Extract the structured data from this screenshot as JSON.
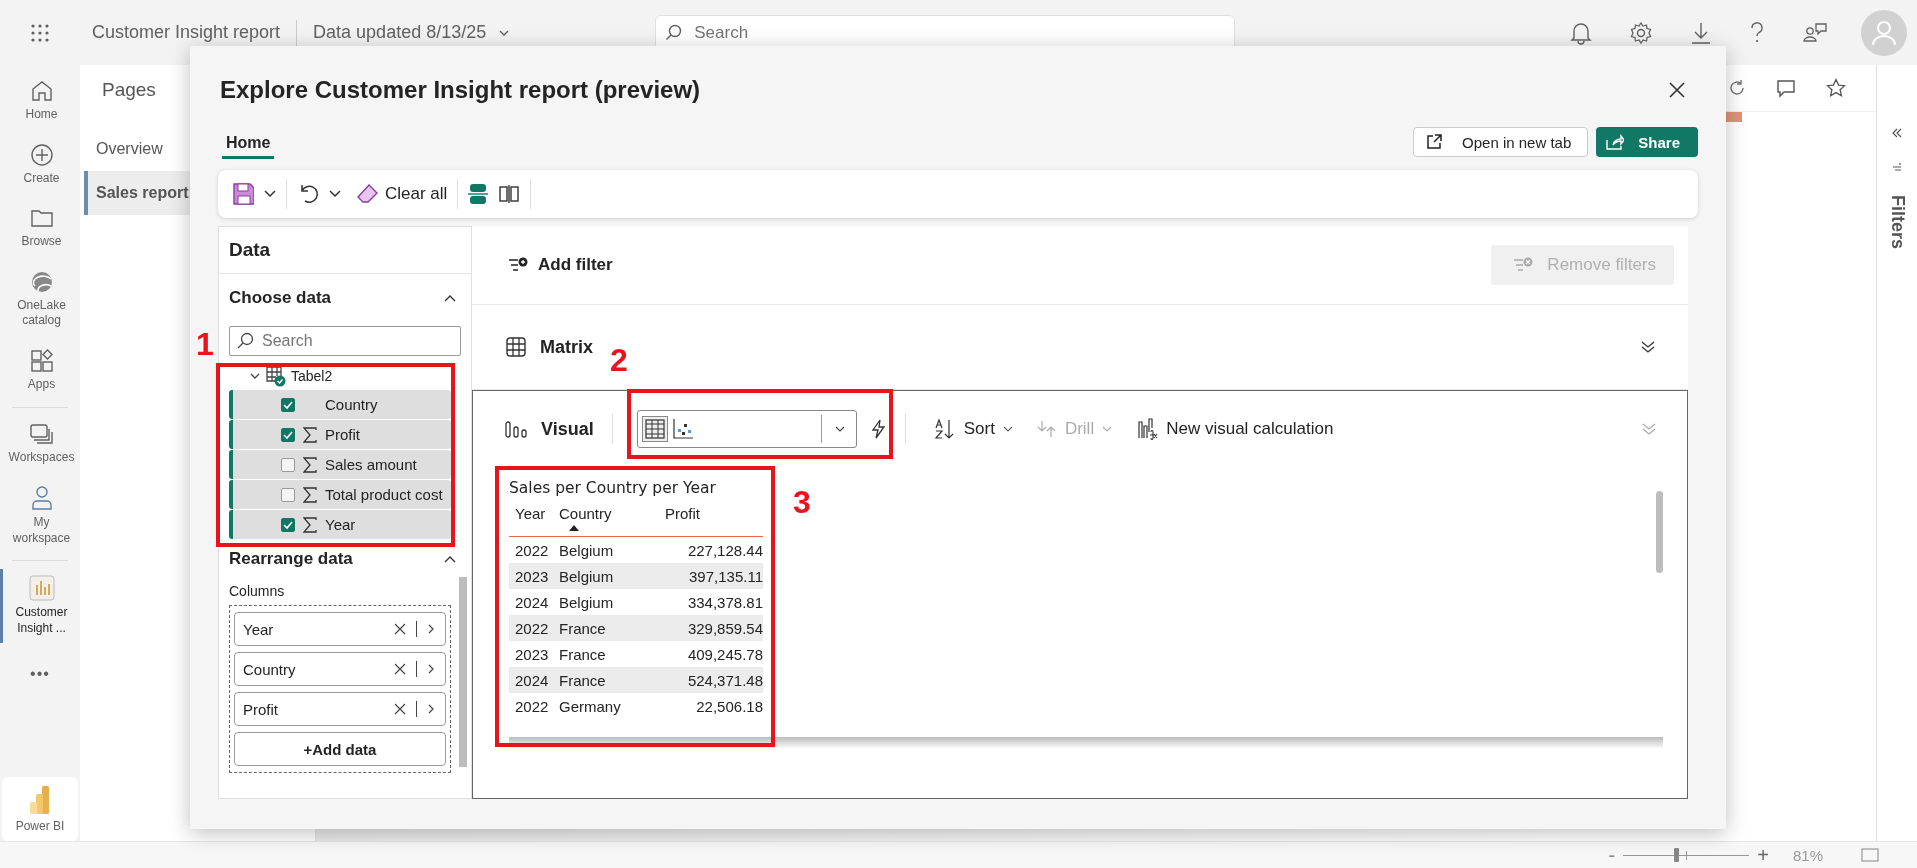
{
  "top_bar": {
    "app_title": "Customer Insight report",
    "data_updated": "Data updated 8/13/25",
    "search": {
      "placeholder": "Search"
    }
  },
  "nav": {
    "items": [
      {
        "label": "Home",
        "selected": false
      },
      {
        "label": "Create",
        "selected": false
      },
      {
        "label": "Browse",
        "selected": false
      },
      {
        "label": "OneLake catalog",
        "selected": false
      },
      {
        "label": "Apps",
        "selected": false
      },
      {
        "label": "Workspaces",
        "selected": false
      },
      {
        "label": "My workspace",
        "selected": false
      },
      {
        "label": "Customer Insight ...",
        "selected": true
      }
    ],
    "more": "•••",
    "product": "Power BI"
  },
  "pages": {
    "title": "Pages",
    "items": [
      {
        "label": "Overview",
        "selected": false
      },
      {
        "label": "Sales report",
        "selected": true
      }
    ]
  },
  "filters_pane": {
    "label": "Filters"
  },
  "status_bar": {
    "zoom_out": "-",
    "zoom_in": "+",
    "zoom": "81%",
    "level": 0.4
  },
  "dialog": {
    "title": "Explore Customer Insight report (preview)",
    "tabs": [
      {
        "label": "Home",
        "selected": true
      }
    ],
    "open_new_tab": "Open in new tab",
    "share": "Share",
    "clear_all": "Clear all",
    "data_pane": {
      "title": "Data",
      "choose_data": "Choose data",
      "search_placeholder": "Search",
      "table": {
        "name": "Tabel2",
        "expanded": true,
        "fields": [
          {
            "name": "Country",
            "checked": true,
            "kind": "text"
          },
          {
            "name": "Profit",
            "checked": true,
            "kind": "measure"
          },
          {
            "name": "Sales amount",
            "checked": false,
            "kind": "measure"
          },
          {
            "name": "Total product cost",
            "checked": false,
            "kind": "measure"
          },
          {
            "name": "Year",
            "checked": true,
            "kind": "measure"
          }
        ]
      },
      "rearrange": "Rearrange data",
      "columns_label": "Columns",
      "columns": [
        "Year",
        "Country",
        "Profit"
      ],
      "add_data": "+Add data"
    },
    "add_filter": "Add filter",
    "remove_filters": {
      "label": "Remove filters",
      "disabled": true
    },
    "matrix": "Matrix",
    "visual": {
      "label": "Visual",
      "sort": "Sort",
      "drill": {
        "label": "Drill",
        "disabled": true
      },
      "new_calc": "New visual calculation"
    },
    "table_visual": {
      "title": "Sales per Country per Year",
      "columns": [
        {
          "label": "Year",
          "sorted": false
        },
        {
          "label": "Country",
          "sorted": true
        },
        {
          "label": "Profit",
          "sorted": false
        }
      ],
      "rows": [
        [
          "2022",
          "Belgium",
          "227,128.44"
        ],
        [
          "2023",
          "Belgium",
          "397,135.11"
        ],
        [
          "2024",
          "Belgium",
          "334,378.81"
        ],
        [
          "2022",
          "France",
          "329,859.54"
        ],
        [
          "2023",
          "France",
          "409,245.78"
        ],
        [
          "2024",
          "France",
          "524,371.48"
        ],
        [
          "2022",
          "Germany",
          "22,506.18"
        ]
      ]
    }
  },
  "annotations": [
    {
      "number": "1"
    },
    {
      "number": "2"
    },
    {
      "number": "3"
    }
  ]
}
